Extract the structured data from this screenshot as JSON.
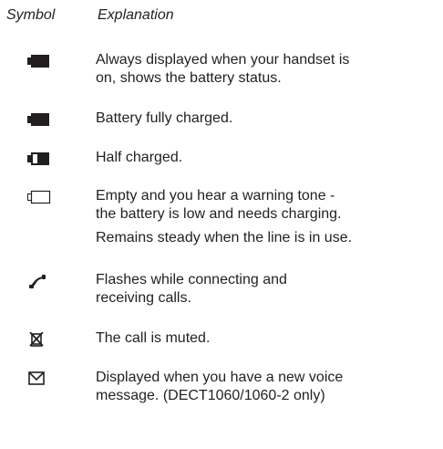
{
  "header": {
    "symbol": "Symbol",
    "explanation": "Explanation"
  },
  "rows": [
    {
      "icon": "battery-full-icon",
      "lines": [
        "Always displayed when your handset is",
        "on, shows the battery status."
      ]
    },
    {
      "icon": "battery-full-icon",
      "lines": [
        "Battery fully charged."
      ]
    },
    {
      "icon": "battery-half-icon",
      "lines": [
        "Half charged."
      ]
    },
    {
      "icon": "battery-empty-icon",
      "lines": [
        "Empty and you hear a warning tone -",
        "the battery is low and needs charging."
      ],
      "extra": "Remains steady when the line is in use."
    },
    {
      "icon": "phone-handset-icon",
      "lines": [
        "Flashes while connecting and",
        "receiving calls."
      ]
    },
    {
      "icon": "mute-icon",
      "lines": [
        "The call is muted."
      ]
    },
    {
      "icon": "envelope-icon",
      "lines": [
        "Displayed when you have a new voice",
        "message. (DECT1060/1060-2 only)"
      ]
    }
  ]
}
